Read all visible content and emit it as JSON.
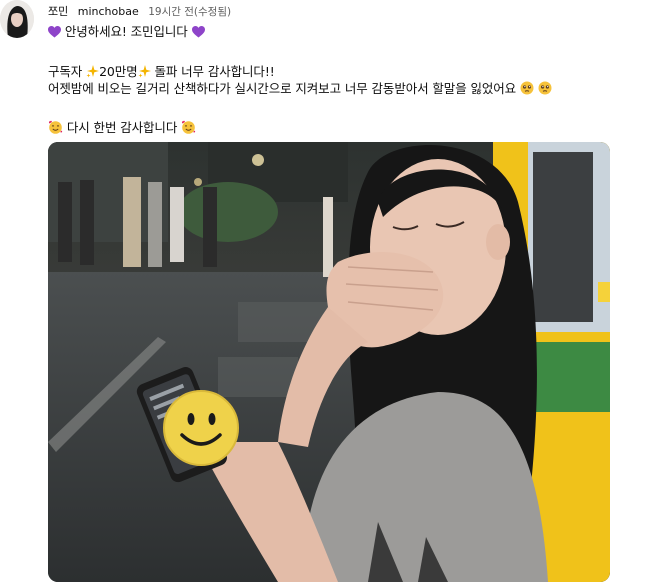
{
  "post": {
    "channel_name": "쪼민",
    "handle": "minchobae",
    "meta": "19시간 전(수정됨)",
    "line1": "안녕하세요! 조민입니다",
    "line2_a": "구독자",
    "line2_b": "20만명",
    "line2_c": "돌파 너무 감사합니다!!",
    "line3": "어젯밤에 비오는 길거리 산책하다가 실시간으로 지켜보고 너무 감동받아서 할말을 잃었어요",
    "line4": "다시 한번 감사합니다"
  },
  "icons": {
    "heart": "purple-heart-icon",
    "sparkles": "sparkles-icon",
    "crying": "pleading-face-icon",
    "smiling_hearts": "smiling-face-with-hearts-icon",
    "sticker": "smiley-face-sticker"
  },
  "colors": {
    "heart": "#8e44c9",
    "sparkle": "#f4b400",
    "emoji_face": "#f6c23b",
    "meta_text": "#606060"
  }
}
